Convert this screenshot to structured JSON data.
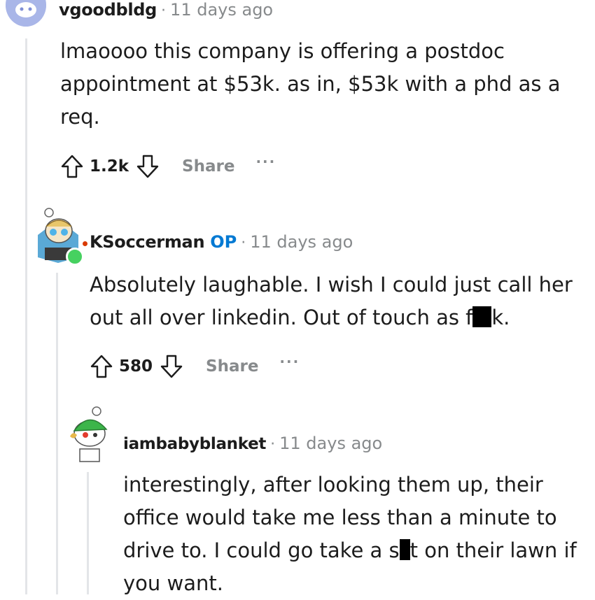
{
  "comments": [
    {
      "username": "vgoodbldg",
      "separator": "·",
      "timestamp": "11 days ago",
      "lines": [
        "lmaoooo this company is offering a postdoc",
        "appointment at $53k. as in, $53k with a phd as a",
        "req."
      ],
      "score": "1.2k",
      "share_label": "Share",
      "more_label": "···"
    },
    {
      "username": "KSoccerman",
      "op_badge": "OP",
      "separator": "·",
      "timestamp": "11 days ago",
      "lines": [
        "Absolutely laughable. I wish I could just call her",
        "out all over linkedin. Out of touch as f",
        "k."
      ],
      "score": "580",
      "share_label": "Share",
      "more_label": "···"
    },
    {
      "username": "iambabyblanket",
      "separator": "·",
      "timestamp": "11 days ago",
      "lines": [
        "interestingly, after looking them up, their",
        "office would take me less than a minute to",
        "drive to. I could go take a s",
        "t on their lawn if",
        "you want."
      ]
    }
  ],
  "colors": {
    "accent": "#0079d3",
    "muted": "#878a8c",
    "text": "#1c1c1c",
    "thread_line": "#e3e5e8",
    "online": "#46d160"
  },
  "icons": [
    "reddit-avatar-icon",
    "upvote-arrow-icon",
    "downvote-arrow-icon",
    "more-options-icon"
  ]
}
